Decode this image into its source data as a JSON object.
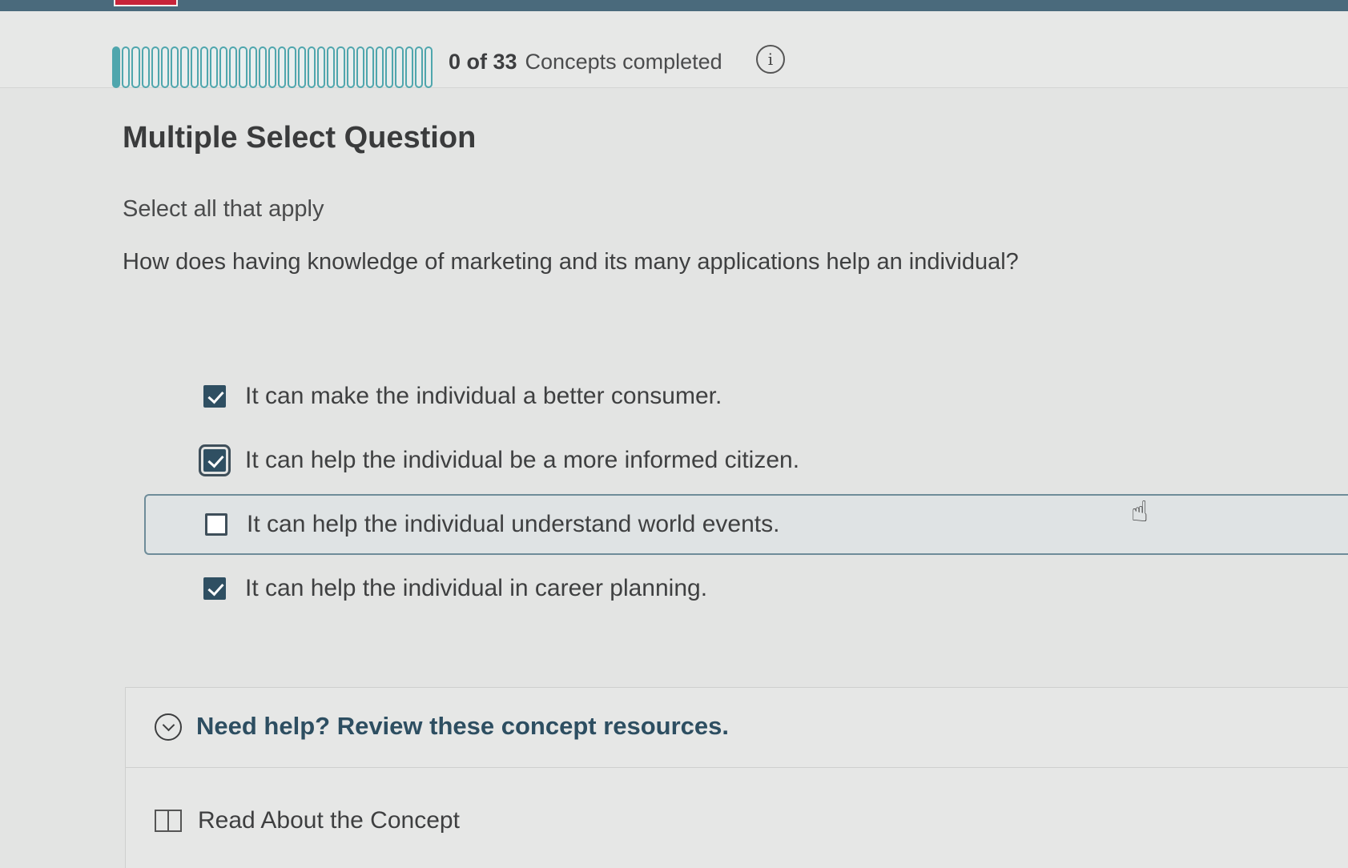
{
  "progress": {
    "completed": 0,
    "total": 33,
    "count_text": "0 of 33",
    "label": "Concepts completed",
    "info_icon": "info-icon"
  },
  "question": {
    "type": "Multiple Select Question",
    "instructions": "Select all that apply",
    "prompt": "How does having knowledge of marketing and its many applications help an individual?",
    "options": [
      {
        "label": "It can make the individual a better consumer.",
        "checked": true
      },
      {
        "label": "It can help the individual be a more informed citizen.",
        "checked": true
      },
      {
        "label": "It can help the individual understand world events.",
        "checked": false
      },
      {
        "label": "It can help the individual in career planning.",
        "checked": true
      }
    ]
  },
  "help": {
    "title": "Need help? Review these concept resources.",
    "read_label": "Read About the Concept"
  },
  "colors": {
    "accent": "#4fa6ad",
    "checkbox": "#2f4f62",
    "help_title": "#2d4e61"
  }
}
